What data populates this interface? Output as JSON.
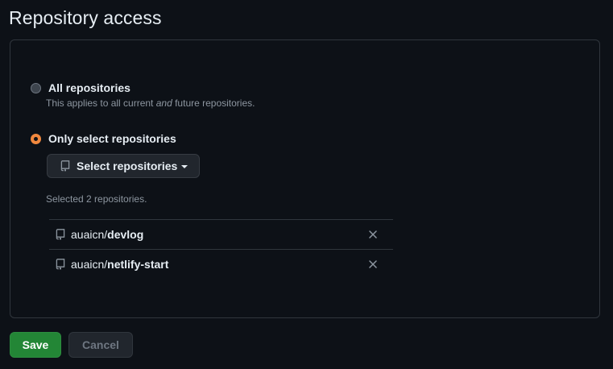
{
  "page": {
    "title": "Repository access"
  },
  "options": {
    "all": {
      "label": "All repositories",
      "desc_before": "This applies to all current ",
      "desc_em": "and",
      "desc_after": " future repositories.",
      "selected": false
    },
    "select": {
      "label": "Only select repositories",
      "selected": true,
      "button_label": "Select repositories",
      "count_text": "Selected 2 repositories."
    }
  },
  "repositories": [
    {
      "owner": "auaicn/",
      "name": "devlog"
    },
    {
      "owner": "auaicn/",
      "name": "netlify-start"
    }
  ],
  "footer": {
    "save_label": "Save",
    "cancel_label": "Cancel"
  },
  "colors": {
    "accent_radio": "#f0883e",
    "save_green": "#238636",
    "background": "#0d1117"
  },
  "icons": {
    "repo": "repo-icon",
    "remove": "close-icon",
    "caret": "triangle-down-icon"
  }
}
